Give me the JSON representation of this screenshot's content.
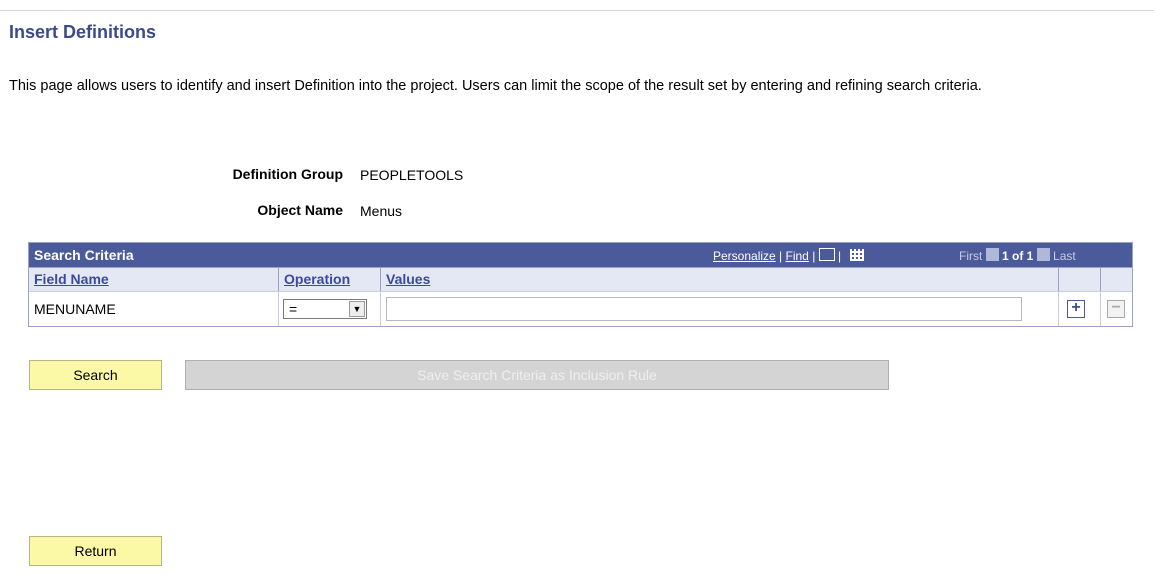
{
  "page": {
    "title": "Insert Definitions",
    "description": "This page allows users to identify and insert Definition into the project. Users can limit the scope of the result set by entering and refining search criteria."
  },
  "fields": {
    "definition_group_label": "Definition Group",
    "definition_group_value": "PEOPLETOOLS",
    "object_name_label": "Object Name",
    "object_name_value": "Menus"
  },
  "grid": {
    "title": "Search Criteria",
    "personalize": "Personalize",
    "find": "Find",
    "nav_first": "First",
    "nav_count": "1 of 1",
    "nav_last": "Last",
    "columns": [
      "Field Name",
      "Operation",
      "Values"
    ],
    "rows": [
      {
        "field_name": "MENUNAME",
        "operation": "=",
        "value": ""
      }
    ],
    "icons": [
      "view-all-icon",
      "download-icon",
      "previous-icon",
      "next-icon",
      "add-row-icon",
      "delete-row-icon",
      "dropdown-arrow-icon"
    ]
  },
  "buttons": {
    "search": "Search",
    "save_rule": "Save Search Criteria as Inclusion Rule",
    "return": "Return"
  }
}
